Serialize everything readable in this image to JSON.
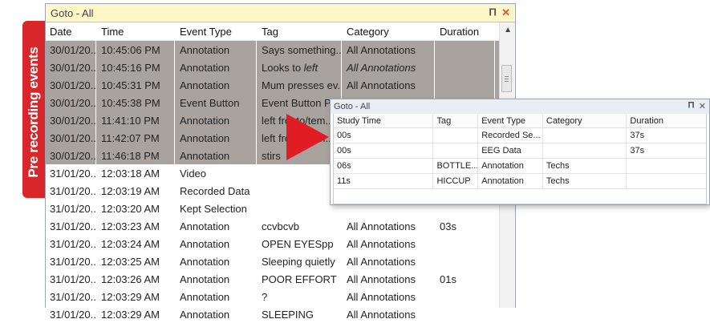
{
  "side_label": "Pre recording events",
  "main_window": {
    "title": "Goto - All",
    "pin_icon": "pin-icon",
    "close_icon": "close-icon",
    "columns": [
      "Date",
      "Time",
      "Event Type",
      "Tag",
      "Category",
      "Duration"
    ],
    "rows": [
      {
        "date": "30/01/20...",
        "time": "10:45:06 PM",
        "type": "Annotation",
        "tag": "Says something...",
        "tag_pre": "",
        "tag_em": "",
        "category": "All Annotations",
        "cat_italic": false,
        "duration": "",
        "selected": true
      },
      {
        "date": "30/01/20...",
        "time": "10:45:16 PM",
        "type": "Annotation",
        "tag": "",
        "tag_pre": "Looks to ",
        "tag_em": "left",
        "category": "All Annotations",
        "cat_italic": true,
        "duration": "",
        "selected": true
      },
      {
        "date": "30/01/20...",
        "time": "10:45:31 PM",
        "type": "Annotation",
        "tag": "Mum presses ev...",
        "tag_pre": "",
        "tag_em": "",
        "category": "All Annotations",
        "cat_italic": false,
        "duration": "",
        "selected": true
      },
      {
        "date": "30/01/20...",
        "time": "10:45:38 PM",
        "type": "Event Button",
        "tag": "Event Button Pr...",
        "tag_pre": "",
        "tag_em": "",
        "category": "",
        "cat_italic": false,
        "duration": "",
        "selected": true
      },
      {
        "date": "30/01/20...",
        "time": "11:41:10 PM",
        "type": "Annotation",
        "tag": "left fronto/tem...",
        "tag_pre": "",
        "tag_em": "",
        "category": "",
        "cat_italic": false,
        "duration": "",
        "selected": true
      },
      {
        "date": "30/01/20...",
        "time": "11:42:07 PM",
        "type": "Annotation",
        "tag": "left fronto/tem...",
        "tag_pre": "",
        "tag_em": "",
        "category": "",
        "cat_italic": false,
        "duration": "",
        "selected": true
      },
      {
        "date": "30/01/20...",
        "time": "11:46:18 PM",
        "type": "Annotation",
        "tag": "stirs",
        "tag_pre": "",
        "tag_em": "",
        "category": "",
        "cat_italic": false,
        "duration": "",
        "selected": true
      },
      {
        "date": "31/01/20...",
        "time": "12:03:18 AM",
        "type": "Video",
        "tag": "",
        "tag_pre": "",
        "tag_em": "",
        "category": "",
        "cat_italic": false,
        "duration": "",
        "selected": false
      },
      {
        "date": "31/01/20...",
        "time": "12:03:19 AM",
        "type": "Recorded Data",
        "tag": "",
        "tag_pre": "",
        "tag_em": "",
        "category": "",
        "cat_italic": false,
        "duration": "",
        "selected": false
      },
      {
        "date": "31/01/20...",
        "time": "12:03:20 AM",
        "type": "Kept Selection",
        "tag": "",
        "tag_pre": "",
        "tag_em": "",
        "category": "",
        "cat_italic": false,
        "duration": "",
        "selected": false
      },
      {
        "date": "31/01/20...",
        "time": "12:03:23 AM",
        "type": "Annotation",
        "tag": "ccvbcvb",
        "tag_pre": "",
        "tag_em": "",
        "category": "All Annotations",
        "cat_italic": false,
        "duration": "03s",
        "selected": false
      },
      {
        "date": "31/01/20...",
        "time": "12:03:24 AM",
        "type": "Annotation",
        "tag": "OPEN EYESpp",
        "tag_pre": "",
        "tag_em": "",
        "category": "All Annotations",
        "cat_italic": false,
        "duration": "",
        "selected": false
      },
      {
        "date": "31/01/20...",
        "time": "12:03:25 AM",
        "type": "Annotation",
        "tag": "Sleeping quietly",
        "tag_pre": "",
        "tag_em": "",
        "category": "All Annotations",
        "cat_italic": false,
        "duration": "",
        "selected": false
      },
      {
        "date": "31/01/20...",
        "time": "12:03:26 AM",
        "type": "Annotation",
        "tag": "POOR EFFORT",
        "tag_pre": "",
        "tag_em": "",
        "category": "All Annotations",
        "cat_italic": false,
        "duration": "01s",
        "selected": false
      },
      {
        "date": "31/01/20...",
        "time": "12:03:29 AM",
        "type": "Annotation",
        "tag": "?",
        "tag_pre": "",
        "tag_em": "",
        "category": "All Annotations",
        "cat_italic": false,
        "duration": "",
        "selected": false
      },
      {
        "date": "31/01/20...",
        "time": "12:03:29 AM",
        "type": "Annotation",
        "tag": "SLEEPING",
        "tag_pre": "",
        "tag_em": "",
        "category": "All Annotations",
        "cat_italic": false,
        "duration": "",
        "selected": false
      }
    ]
  },
  "overlay_window": {
    "title": "Goto - All",
    "columns": [
      "Study Time",
      "Tag",
      "Event Type",
      "Category",
      "Duration"
    ],
    "rows": [
      {
        "study_time": "00s",
        "tag": "",
        "type": "Recorded Se...",
        "category": "",
        "duration": "37s"
      },
      {
        "study_time": "00s",
        "tag": "",
        "type": "EEG Data",
        "category": "",
        "duration": "37s"
      },
      {
        "study_time": "06s",
        "tag": "BOTTLE...",
        "type": "Annotation",
        "category": "Techs",
        "duration": ""
      },
      {
        "study_time": "11s",
        "tag": "HICCUP",
        "type": "Annotation",
        "category": "Techs",
        "duration": ""
      }
    ]
  },
  "colors": {
    "badge_red": "#d8262b",
    "arrow_red": "#e01d24",
    "selected_row": "#a9a39f",
    "title_bar": "#fff6c9"
  }
}
